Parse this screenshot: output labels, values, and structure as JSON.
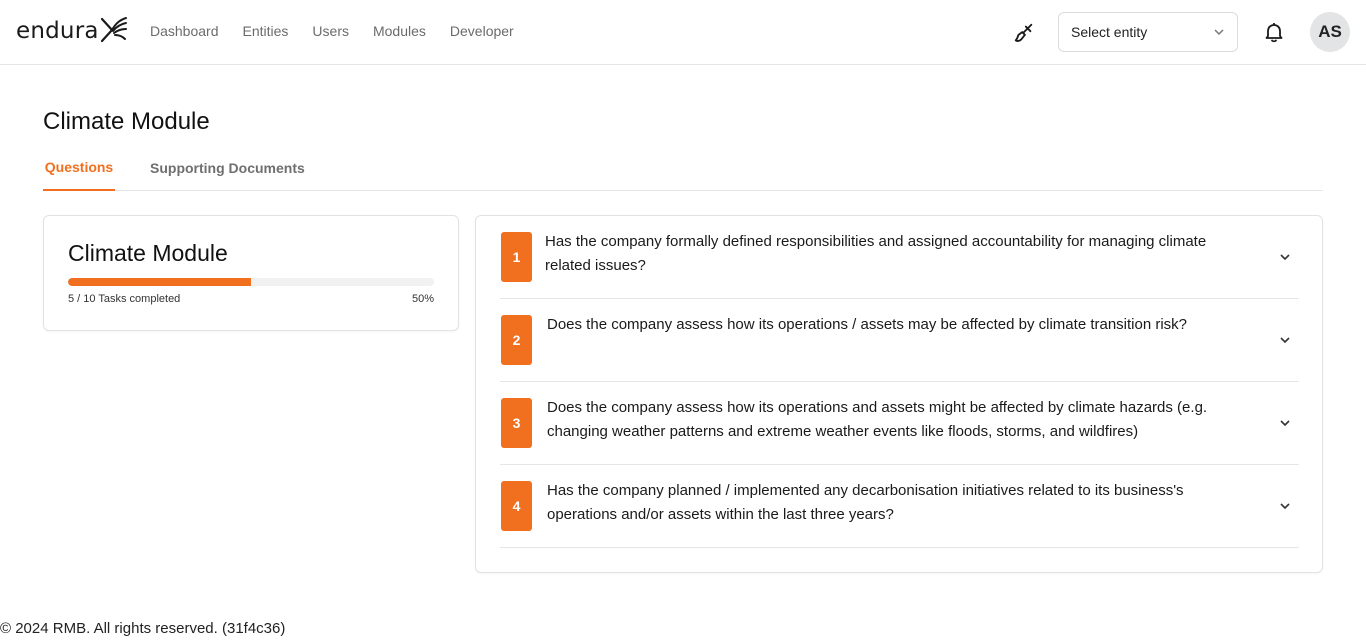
{
  "brand": {
    "name": "endura"
  },
  "nav": {
    "items": [
      "Dashboard",
      "Entities",
      "Users",
      "Modules",
      "Developer"
    ]
  },
  "header": {
    "entity_select": {
      "label": "Select entity"
    },
    "avatar_initials": "AS"
  },
  "page": {
    "title": "Climate Module",
    "tabs": [
      {
        "label": "Questions",
        "active": true
      },
      {
        "label": "Supporting Documents",
        "active": false
      }
    ]
  },
  "progress_card": {
    "title": "Climate Module",
    "completed": 5,
    "total": 10,
    "tasks_label": "5 / 10 Tasks completed",
    "percent_label": "50%",
    "fraction": 0.5
  },
  "questions": [
    {
      "number": "1",
      "text": "Has the company formally defined responsibilities and assigned accountability for managing climate related issues?"
    },
    {
      "number": "2",
      "text": "Does the company assess how its operations / assets may be affected by climate transition risk?"
    },
    {
      "number": "3",
      "text": "Does the company assess how its operations and assets might be affected by climate hazards (e.g. changing weather patterns and extreme weather events like floods, storms, and wildfires)"
    },
    {
      "number": "4",
      "text": "Has the company planned / implemented any decarbonisation initiatives related to its business's operations and/or assets within the last three years?"
    }
  ],
  "footer": {
    "text": "© 2024 RMB. All rights reserved. (31f4c36)"
  },
  "colors": {
    "accent": "#f07020",
    "border": "#e2e2e2",
    "muted": "#6b6b6b"
  }
}
